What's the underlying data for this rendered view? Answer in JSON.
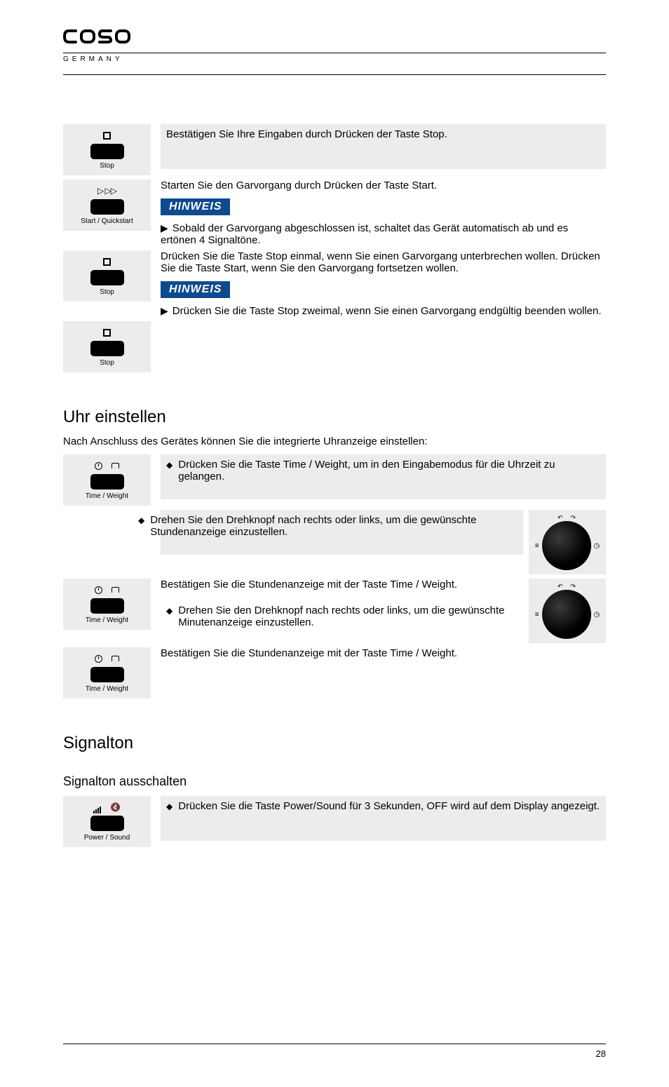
{
  "brand": {
    "name": "caso",
    "subtitle": "GERMANY"
  },
  "hinweis_label": "HINWEIS",
  "buttons": {
    "stop_label": "Stop",
    "start_label": "Start / Quickstart",
    "timeweight_label": "Time / Weight",
    "powersound_label": "Power / Sound"
  },
  "rows": {
    "r1": "Bestätigen Sie Ihre Eingaben durch Drücken der Taste Stop.",
    "r2_main": "Starten Sie den Garvorgang durch Drücken der Taste Start.",
    "r2_note": "Sobald der Garvorgang abgeschlossen ist, schaltet das Gerät automatisch ab und es ertönen 4 Signaltöne.",
    "r3_main": "Drücken Sie die Taste Stop einmal, wenn Sie einen Garvorgang unterbrechen wollen. Drücken Sie die Taste Start, wenn Sie den Garvorgang fortsetzen wollen.",
    "r3_note": "Drücken Sie die Taste Stop zweimal, wenn Sie einen Garvorgang endgültig beenden wollen.",
    "r4_main": ""
  },
  "clock": {
    "title": "Uhr einstellen",
    "intro": "Nach Anschluss des Gerätes können Sie die integrierte Uhranzeige einstellen:",
    "s1": "Drücken Sie die Taste Time / Weight, um in den Eingabemodus für die Uhrzeit zu gelangen.",
    "s2": "Drehen Sie den Drehknopf nach rechts oder links, um die gewünschte Stundenanzeige einzustellen.",
    "s3_a": "Bestätigen Sie die Stundenanzeige mit der Taste Time / Weight.",
    "s3_b": "Drehen Sie den Drehknopf nach rechts oder links, um die gewünschte Minutenanzeige einzustellen.",
    "s4": "Bestätigen Sie die Stundenanzeige mit der Taste Time / Weight."
  },
  "sound": {
    "title": "Signalton",
    "sub": "Signalton ausschalten",
    "step": "Drücken Sie die Taste Power/Sound für 3 Sekunden, OFF wird auf dem Display angezeigt."
  },
  "page_number": "28"
}
